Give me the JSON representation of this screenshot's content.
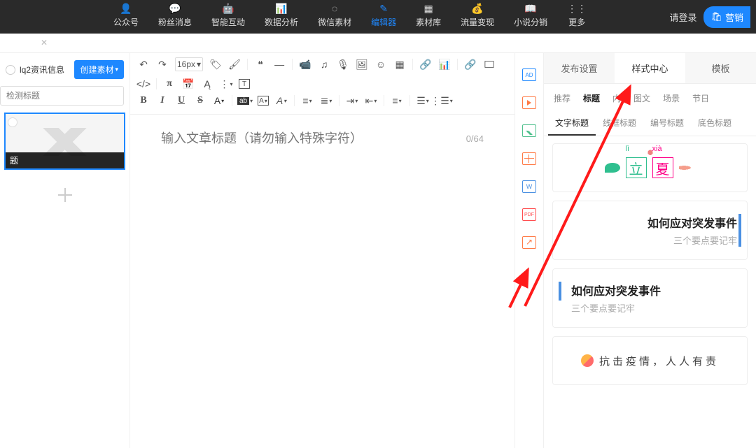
{
  "nav": {
    "items": [
      {
        "label": "公众号"
      },
      {
        "label": "粉丝消息"
      },
      {
        "label": "智能互动"
      },
      {
        "label": "数据分析"
      },
      {
        "label": "微信素材"
      },
      {
        "label": "编辑器"
      },
      {
        "label": "素材库"
      },
      {
        "label": "流量变现"
      },
      {
        "label": "小说分销"
      },
      {
        "label": "更多"
      }
    ],
    "active_index": 5,
    "login": "请登录",
    "marketing": "营销"
  },
  "left": {
    "account": "lq2资讯信息",
    "create": "创建素材",
    "search_placeholder": "检测标题",
    "thumb_caption": "题"
  },
  "editor": {
    "title_placeholder": "输入文章标题（请勿输入特殊字符）",
    "counter": "0/64",
    "font_size": "16px"
  },
  "rail": {
    "ad": "AD",
    "w": "W",
    "pdf": "PDF"
  },
  "right": {
    "tabs": [
      {
        "label": "发布设置"
      },
      {
        "label": "样式中心"
      },
      {
        "label": "模板"
      }
    ],
    "tabs_active": 1,
    "cats": [
      "推荐",
      "标题",
      "内",
      "图文",
      "场景",
      "节日"
    ],
    "cats_active": 1,
    "subs": [
      "文字标题",
      "线框标题",
      "编号标题",
      "底色标题"
    ],
    "subs_active": 0,
    "cards": {
      "lixia": {
        "pin1": "lì",
        "pin2": "xià",
        "c1": "立",
        "c2": "夏"
      },
      "c2": {
        "t": "如何应对突发事件",
        "s": "三个要点要记牢"
      },
      "c3": {
        "t": "如何应对突发事件",
        "s": "三个要点要记牢"
      },
      "c4": {
        "t": "抗击疫情，人人有责"
      }
    }
  }
}
